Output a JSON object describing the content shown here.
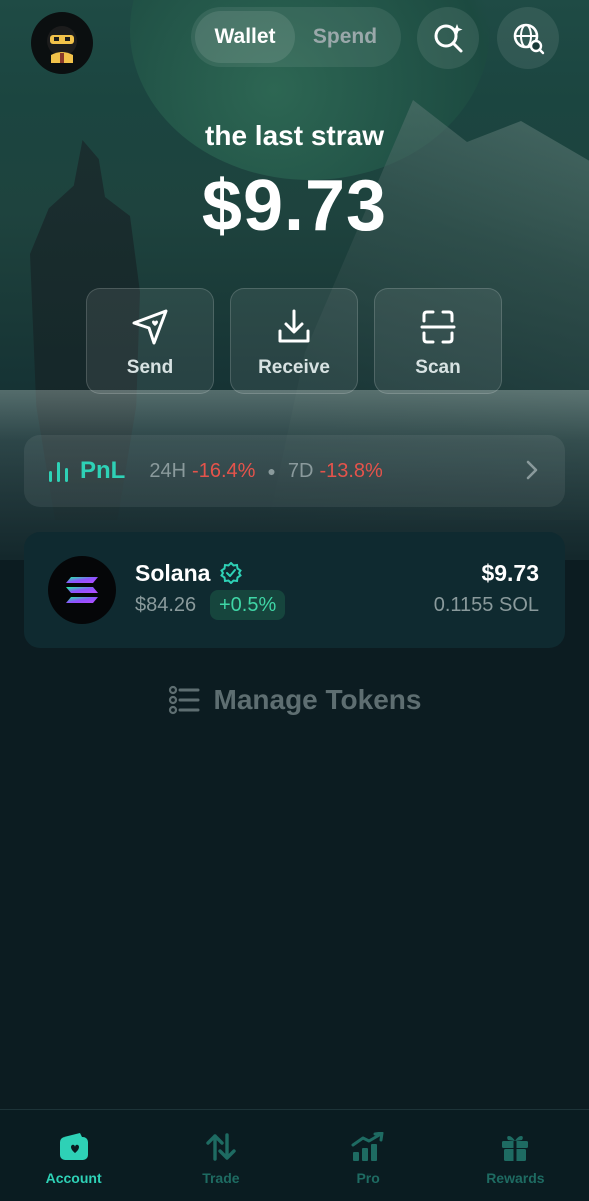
{
  "header": {
    "avatar": "ninja-avatar",
    "toggle": {
      "active": "Wallet",
      "inactive": "Spend"
    },
    "icons": [
      "search-sparkle-icon",
      "globe-search-icon"
    ]
  },
  "wallet": {
    "name": "the last straw",
    "balance": "$9.73"
  },
  "actions": [
    {
      "label": "Send",
      "icon": "send-arrow-icon"
    },
    {
      "label": "Receive",
      "icon": "download-icon"
    },
    {
      "label": "Scan",
      "icon": "scan-icon"
    }
  ],
  "pnl": {
    "title": "PnL",
    "period_1": "24H",
    "value_1": "-16.4%",
    "period_2": "7D",
    "value_2": "-13.8%"
  },
  "token": {
    "name": "Solana",
    "price": "$84.26",
    "change": "+0.5%",
    "value": "$9.73",
    "amount": "0.1155 SOL"
  },
  "manage_tokens": "Manage Tokens",
  "nav": [
    {
      "label": "Account",
      "icon": "wallet-icon",
      "active": true
    },
    {
      "label": "Trade",
      "icon": "swap-arrows-icon",
      "active": false
    },
    {
      "label": "Pro",
      "icon": "chart-growth-icon",
      "active": false
    },
    {
      "label": "Rewards",
      "icon": "gift-icon",
      "active": false
    }
  ],
  "colors": {
    "accent": "#2ed1b6",
    "negative": "#e5534b",
    "positive": "#3fd6a6",
    "background": "#0c1c21"
  }
}
